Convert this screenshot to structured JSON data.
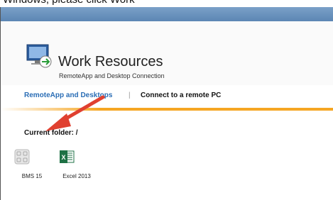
{
  "caption": "Windows, please click Work",
  "header": {
    "title": "Work Resources",
    "subtitle": "RemoteApp and Desktop Connection"
  },
  "nav": {
    "remoteapp": "RemoteApp and Desktops",
    "separator": "|",
    "connect": "Connect to a remote PC"
  },
  "folder": {
    "label": "Current folder: /"
  },
  "apps": [
    {
      "label": "BMS 15",
      "icon": "generic-app-icon"
    },
    {
      "label": "Excel 2013",
      "icon": "excel-icon"
    }
  ],
  "colors": {
    "accent": "#f5a623",
    "link": "#2a6db5",
    "annotation_arrow": "#e04030"
  }
}
